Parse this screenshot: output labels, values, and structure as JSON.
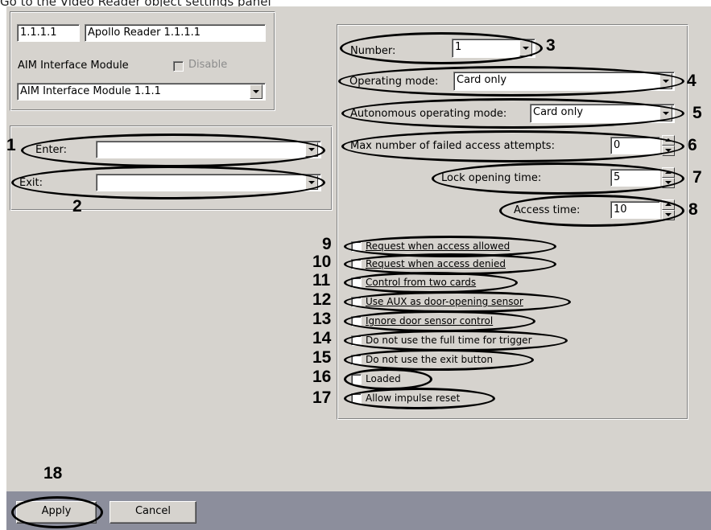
{
  "caption": "Go to the Video Reader object settings panel",
  "reader": {
    "id": "1.1.1.1",
    "name": "Apollo Reader 1.1.1.1",
    "parent_label": "AIM Interface Module",
    "disable_label": "Disable",
    "parent_value": "AIM Interface Module 1.1.1"
  },
  "doors": {
    "enter_label": "Enter:",
    "enter_value": "",
    "exit_label": "Exit:",
    "exit_value": ""
  },
  "settings": {
    "number_label": "Number:",
    "number_value": "1",
    "operating_mode_label": "Operating mode:",
    "operating_mode_value": "Card only",
    "autonomous_label": "Autonomous operating mode:",
    "autonomous_value": "Card only",
    "max_failed_label": "Max number of failed access attempts:",
    "max_failed_value": "0",
    "lock_time_label": "Lock opening time:",
    "lock_time_value": "5",
    "access_time_label": "Access time:",
    "access_time_value": "10"
  },
  "checkboxes": [
    {
      "label": "Request when access allowed",
      "checked": false
    },
    {
      "label": "Request when access denied",
      "checked": false
    },
    {
      "label": "Control from two cards",
      "checked": false
    },
    {
      "label": "Use AUX as door-opening sensor",
      "checked": false
    },
    {
      "label": "Ignore door sensor control",
      "checked": false
    },
    {
      "label": "Do not use the full time for trigger",
      "checked": false
    },
    {
      "label": "Do not use the exit button",
      "checked": false
    },
    {
      "label": "Loaded",
      "checked": false
    },
    {
      "label": "Allow impulse reset",
      "checked": false
    }
  ],
  "callouts": [
    "1",
    "2",
    "3",
    "4",
    "5",
    "6",
    "7",
    "8",
    "9",
    "10",
    "11",
    "12",
    "13",
    "14",
    "15",
    "16",
    "17",
    "18"
  ],
  "buttons": {
    "apply": "Apply",
    "cancel": "Cancel"
  },
  "colors": {
    "face": "#d6d3ce",
    "bottom_bar": "#8c8e9c",
    "callout": "#000000"
  }
}
